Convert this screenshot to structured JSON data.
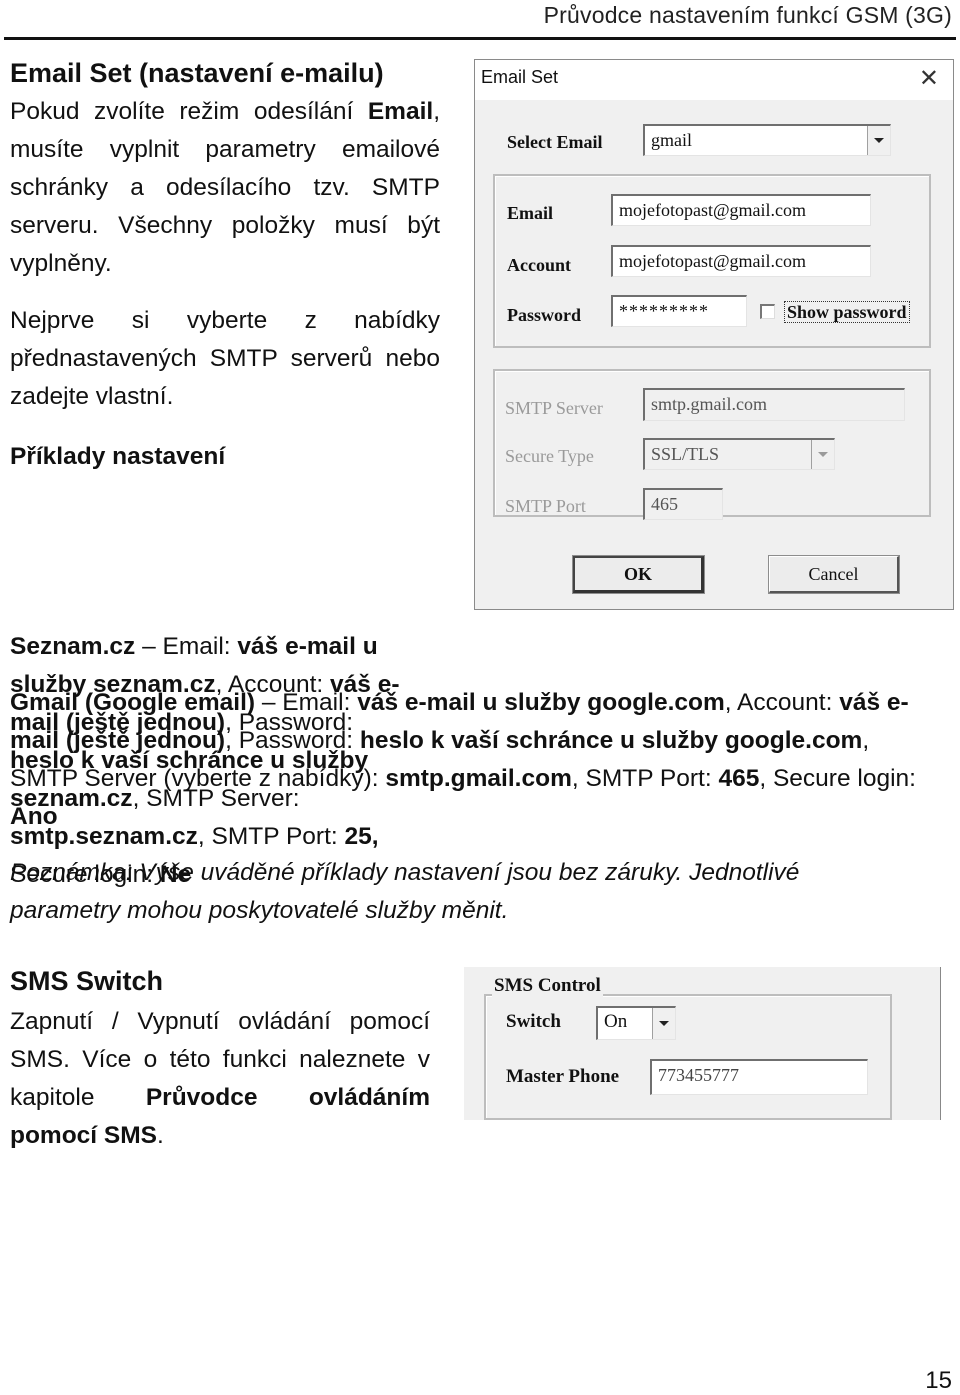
{
  "header": {
    "title": "Průvodce nastavením funkcí GSM (3G)"
  },
  "email_section": {
    "heading": "Email Set (nastavení e-mailu)",
    "intro": [
      {
        "t": "Pokud zvolíte režim odesílání ",
        "b": false
      },
      {
        "t": "Email",
        "b": true
      },
      {
        "t": ", musíte vyplnit parametry emailové schránky a odesílacího tzv. SMTP serveru. Všechny položky musí být vyplněny.",
        "b": false
      }
    ],
    "instruction": "Nejprve si vyberte z nabídky přednastavených SMTP serverů nebo zadejte vlastní.",
    "examples_heading": "Příklady nastavení",
    "seznam_example": [
      {
        "t": "Seznam.cz",
        "b": true
      },
      {
        "t": "  – Email: ",
        "b": false
      },
      {
        "t": "váš e-mail u služby seznam.cz",
        "b": true
      },
      {
        "t": ", Account: ",
        "b": false
      },
      {
        "t": "váš e-mail (ještě jednou)",
        "b": true
      },
      {
        "t": ", Password: ",
        "b": false
      },
      {
        "t": "heslo k vaší schránce u služby seznam.cz",
        "b": true
      },
      {
        "t": ", SMTP Server: ",
        "b": false
      },
      {
        "t": "smtp.seznam.cz",
        "b": true
      },
      {
        "t": ", SMTP Port: ",
        "b": false
      },
      {
        "t": "25,",
        "b": true
      },
      {
        "t": " Secure login: ",
        "b": false
      },
      {
        "t": "Ne",
        "b": true
      }
    ],
    "gmail_example": [
      {
        "t": "Gmail (Google email)",
        "b": true
      },
      {
        "t": "  – Email: ",
        "b": false
      },
      {
        "t": "váš e-mail u služby google.com",
        "b": true
      },
      {
        "t": ", Account: ",
        "b": false
      },
      {
        "t": "váš e-mail (ještě jednou)",
        "b": true
      },
      {
        "t": ", Password: ",
        "b": false
      },
      {
        "t": "heslo k vaší schránce u služby google.com",
        "b": true
      },
      {
        "t": ", SMTP Server (vyberte z nabídky): ",
        "b": false
      },
      {
        "t": "smtp.gmail.com",
        "b": true
      },
      {
        "t": ", SMTP Port: ",
        "b": false
      },
      {
        "t": "465",
        "b": true
      },
      {
        "t": ", Secure login: ",
        "b": false
      },
      {
        "t": "Ano",
        "b": true
      }
    ],
    "note": "Poznámka: Výše uváděné příklady nastavení jsou bez záruky. Jednotlivé parametry mohou poskytovatelé služby měnit."
  },
  "email_dialog": {
    "title": "Email Set",
    "close_icon": "close-icon",
    "select_email_label": "Select Email",
    "select_email_value": "gmail",
    "email_label": "Email",
    "email_value": "mojefotopast@gmail.com",
    "account_label": "Account",
    "account_value": "mojefotopast@gmail.com",
    "password_label": "Password",
    "password_value": "*********",
    "show_password_label": "Show password",
    "show_password_checked": false,
    "smtp_server_label": "SMTP Server",
    "smtp_server_value": "smtp.gmail.com",
    "secure_type_label": "Secure Type",
    "secure_type_value": "SSL/TLS",
    "smtp_port_label": "SMTP Port",
    "smtp_port_value": "465",
    "ok_label": "OK",
    "cancel_label": "Cancel"
  },
  "sms_section": {
    "heading": "SMS Switch",
    "body": [
      {
        "t": "Zapnutí / Vypnutí ovládání pomocí SMS. Více o této funkci naleznete v kapitole ",
        "b": false
      },
      {
        "t": "Průvodce ovládáním pomocí SMS",
        "b": true
      },
      {
        "t": ".",
        "b": false
      }
    ]
  },
  "sms_dialog": {
    "group_title": "SMS Control",
    "switch_label": "Switch",
    "switch_value": "On",
    "master_phone_label": "Master Phone",
    "master_phone_value": "773455777"
  },
  "footer": {
    "page_number": "15"
  }
}
